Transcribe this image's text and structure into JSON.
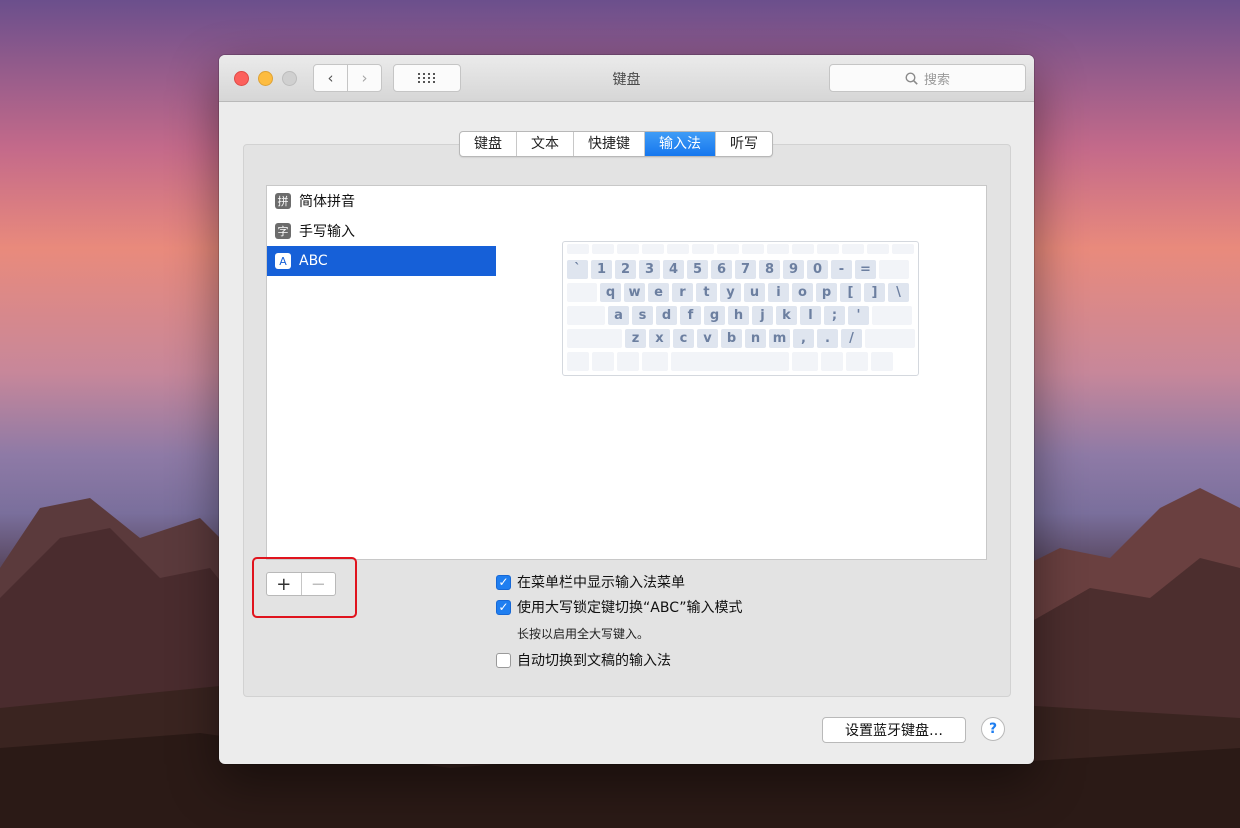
{
  "window": {
    "title": "键盘"
  },
  "titlebar": {
    "search_placeholder": "搜索",
    "back_icon": "‹",
    "forward_icon": "›"
  },
  "tabs": [
    "键盘",
    "文本",
    "快捷键",
    "输入法",
    "听写"
  ],
  "selected_tab": "输入法",
  "input_sources": [
    {
      "icon": "拼",
      "label": "简体拼音",
      "selected": false
    },
    {
      "icon": "字",
      "label": "手写输入",
      "selected": false
    },
    {
      "icon": "A",
      "label": "ABC",
      "selected": true
    }
  ],
  "keyboard_rows": [
    [
      "`",
      "1",
      "2",
      "3",
      "4",
      "5",
      "6",
      "7",
      "8",
      "9",
      "0",
      "-",
      "="
    ],
    [
      "q",
      "w",
      "e",
      "r",
      "t",
      "y",
      "u",
      "i",
      "o",
      "p",
      "[",
      "]",
      "\\"
    ],
    [
      "a",
      "s",
      "d",
      "f",
      "g",
      "h",
      "j",
      "k",
      "l",
      ";",
      "'"
    ],
    [
      "z",
      "x",
      "c",
      "v",
      "b",
      "n",
      "m",
      ",",
      ".",
      "/"
    ]
  ],
  "list_controls": {
    "add": "+",
    "remove": "−"
  },
  "options": [
    {
      "label": "在菜单栏中显示输入法菜单",
      "checked": true
    },
    {
      "label": "使用大写锁定键切换“ABC”输入模式",
      "checked": true
    },
    {
      "label": "自动切换到文稿的输入法",
      "checked": false
    }
  ],
  "caps_hint": "长按以启用全大写键入。",
  "bluetooth_button": "设置蓝牙键盘…",
  "help_button": "?",
  "colors": {
    "accent": "#1660d8",
    "highlight": "#e0141e"
  }
}
